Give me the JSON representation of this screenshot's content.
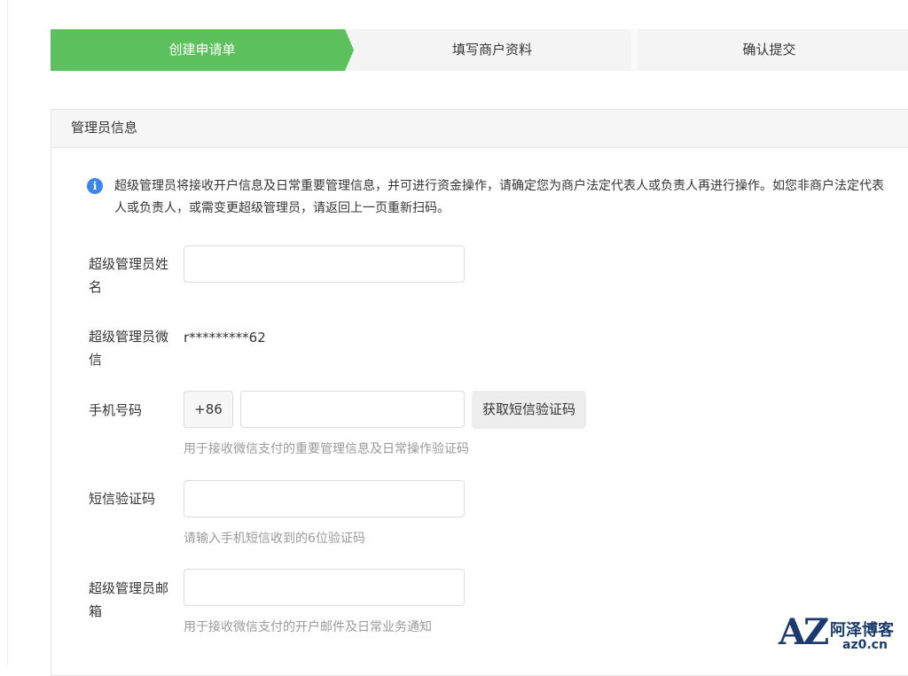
{
  "steps": [
    {
      "label": "创建申请单",
      "active": true
    },
    {
      "label": "填写商户资料",
      "active": false
    },
    {
      "label": "确认提交",
      "active": false
    }
  ],
  "colors": {
    "accent": "#5cc05c",
    "info": "#3e86e8",
    "hint": "#9a9a9a"
  },
  "section": {
    "title": "管理员信息"
  },
  "notice": {
    "icon": "info-icon",
    "text": "超级管理员将接收开户信息及日常重要管理信息，并可进行资金操作，请确定您为商户法定代表人或负责人再进行操作。如您非商户法定代表人或负责人，或需变更超级管理员，请返回上一页重新扫码。"
  },
  "form": {
    "admin_name": {
      "label": "超级管理员姓名",
      "value": ""
    },
    "admin_wechat": {
      "label": "超级管理员微信",
      "value": "r*********62"
    },
    "phone": {
      "label": "手机号码",
      "prefix": "+86",
      "value": "",
      "button": "获取短信验证码",
      "hint": "用于接收微信支付的重要管理信息及日常操作验证码"
    },
    "sms_code": {
      "label": "短信验证码",
      "value": "",
      "hint": "请输入手机短信收到的6位验证码"
    },
    "admin_email": {
      "label": "超级管理员邮箱",
      "value": "",
      "hint": "用于接收微信支付的开户邮件及日常业务通知"
    }
  },
  "watermark": {
    "logo_mark": "AZ",
    "name": "阿泽博客",
    "url": "az0.cn"
  }
}
